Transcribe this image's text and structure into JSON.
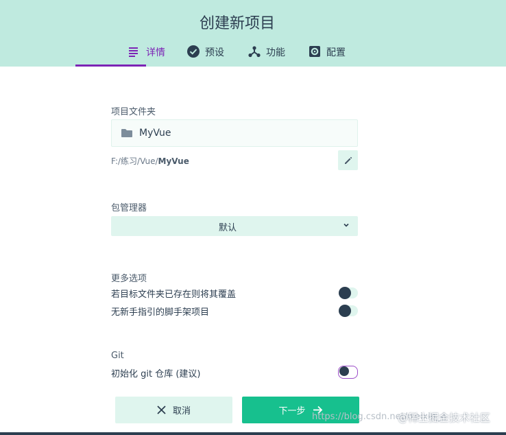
{
  "header": {
    "title": "创建新项目",
    "tabs": [
      {
        "label": "详情",
        "icon": "details-icon",
        "active": true
      },
      {
        "label": "预设",
        "icon": "check-circle-icon",
        "active": false
      },
      {
        "label": "功能",
        "icon": "features-icon",
        "active": false
      },
      {
        "label": "配置",
        "icon": "settings-icon",
        "active": false
      }
    ]
  },
  "folder": {
    "label": "项目文件夹",
    "name": "MyVue",
    "path_prefix": "F:/练习/Vue/",
    "path_name": "MyVue"
  },
  "package_manager": {
    "label": "包管理器",
    "selected": "默认"
  },
  "more_options": {
    "label": "更多选项",
    "items": [
      {
        "label": "若目标文件夹已存在则将其覆盖",
        "enabled": false
      },
      {
        "label": "无新手指引的脚手架项目",
        "enabled": false
      }
    ]
  },
  "git": {
    "label": "Git",
    "init_label": "初始化 git 仓库 (建议)",
    "enabled": false
  },
  "footer": {
    "cancel_label": "取消",
    "next_label": "下一步"
  },
  "watermark": {
    "url": "https://blog.csdn.net/weixin_4",
    "brand": "@稀土掘金技术社区"
  },
  "colors": {
    "header_bg": "#bfeadf",
    "accent": "#7c24b5",
    "primary": "#17c08e",
    "text": "#2c3e50"
  }
}
